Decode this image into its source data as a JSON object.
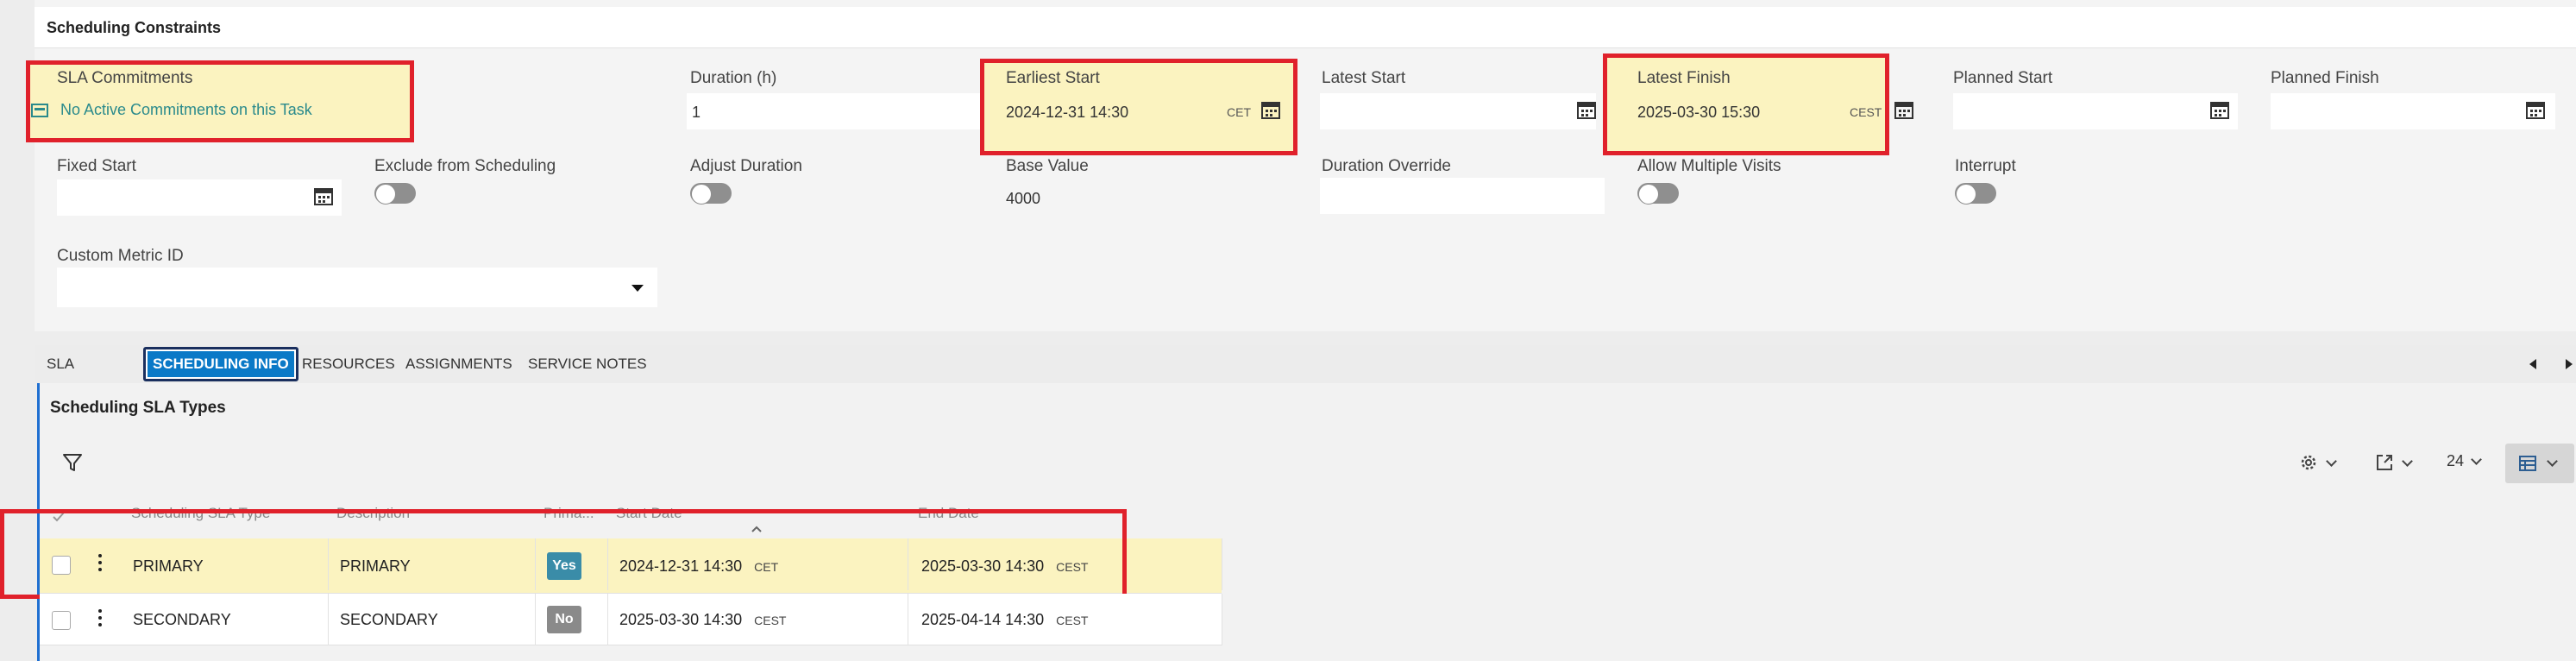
{
  "constraints": {
    "title": "Scheduling Constraints",
    "fields": {
      "sla_commitments": {
        "label": "SLA Commitments",
        "value": "No Active Commitments on this Task"
      },
      "duration": {
        "label": "Duration (h)",
        "value": "1"
      },
      "earliest_start": {
        "label": "Earliest Start",
        "value": "2024-12-31 14:30",
        "tz": "CET"
      },
      "latest_start": {
        "label": "Latest Start",
        "value": ""
      },
      "latest_finish": {
        "label": "Latest Finish",
        "value": "2025-03-30 15:30",
        "tz": "CEST"
      },
      "planned_start": {
        "label": "Planned Start",
        "value": ""
      },
      "planned_finish": {
        "label": "Planned Finish",
        "value": ""
      },
      "fixed_start": {
        "label": "Fixed Start",
        "value": ""
      },
      "exclude_from_scheduling": {
        "label": "Exclude from Scheduling",
        "on": false
      },
      "adjust_duration": {
        "label": "Adjust Duration",
        "on": false
      },
      "base_value": {
        "label": "Base Value",
        "value": "4000"
      },
      "duration_override": {
        "label": "Duration Override",
        "value": ""
      },
      "allow_multiple_visits": {
        "label": "Allow Multiple Visits",
        "on": false
      },
      "interrupt": {
        "label": "Interrupt",
        "on": false
      },
      "custom_metric_id": {
        "label": "Custom Metric ID",
        "value": ""
      }
    }
  },
  "tabs": [
    {
      "label": "SLA",
      "active": false
    },
    {
      "label": "SCHEDULING INFO",
      "active": true
    },
    {
      "label": "RESOURCES",
      "active": false
    },
    {
      "label": "ASSIGNMENTS",
      "active": false
    },
    {
      "label": "SERVICE NOTES",
      "active": false
    }
  ],
  "sla_types": {
    "title": "Scheduling SLA Types",
    "toolbar": {
      "page_size": "24"
    },
    "columns": [
      "Scheduling SLA Type",
      "Description",
      "Prima...",
      "Start Date",
      "End Date"
    ],
    "rows": [
      {
        "type": "PRIMARY",
        "description": "PRIMARY",
        "primary": "Yes",
        "start": "2024-12-31 14:30",
        "start_tz": "CET",
        "end": "2025-03-30 14:30",
        "end_tz": "CEST",
        "highlighted": true
      },
      {
        "type": "SECONDARY",
        "description": "SECONDARY",
        "primary": "No",
        "start": "2025-03-30 14:30",
        "start_tz": "CEST",
        "end": "2025-04-14 14:30",
        "end_tz": "CEST",
        "highlighted": false
      }
    ]
  },
  "colors": {
    "highlight": "#fbf3c0",
    "annotation_red": "#e0212b",
    "accent_blue": "#0a79c7",
    "link_teal": "#2a8a8c",
    "badge_yes": "#3a8ca8",
    "badge_no": "#8a8a8a"
  }
}
